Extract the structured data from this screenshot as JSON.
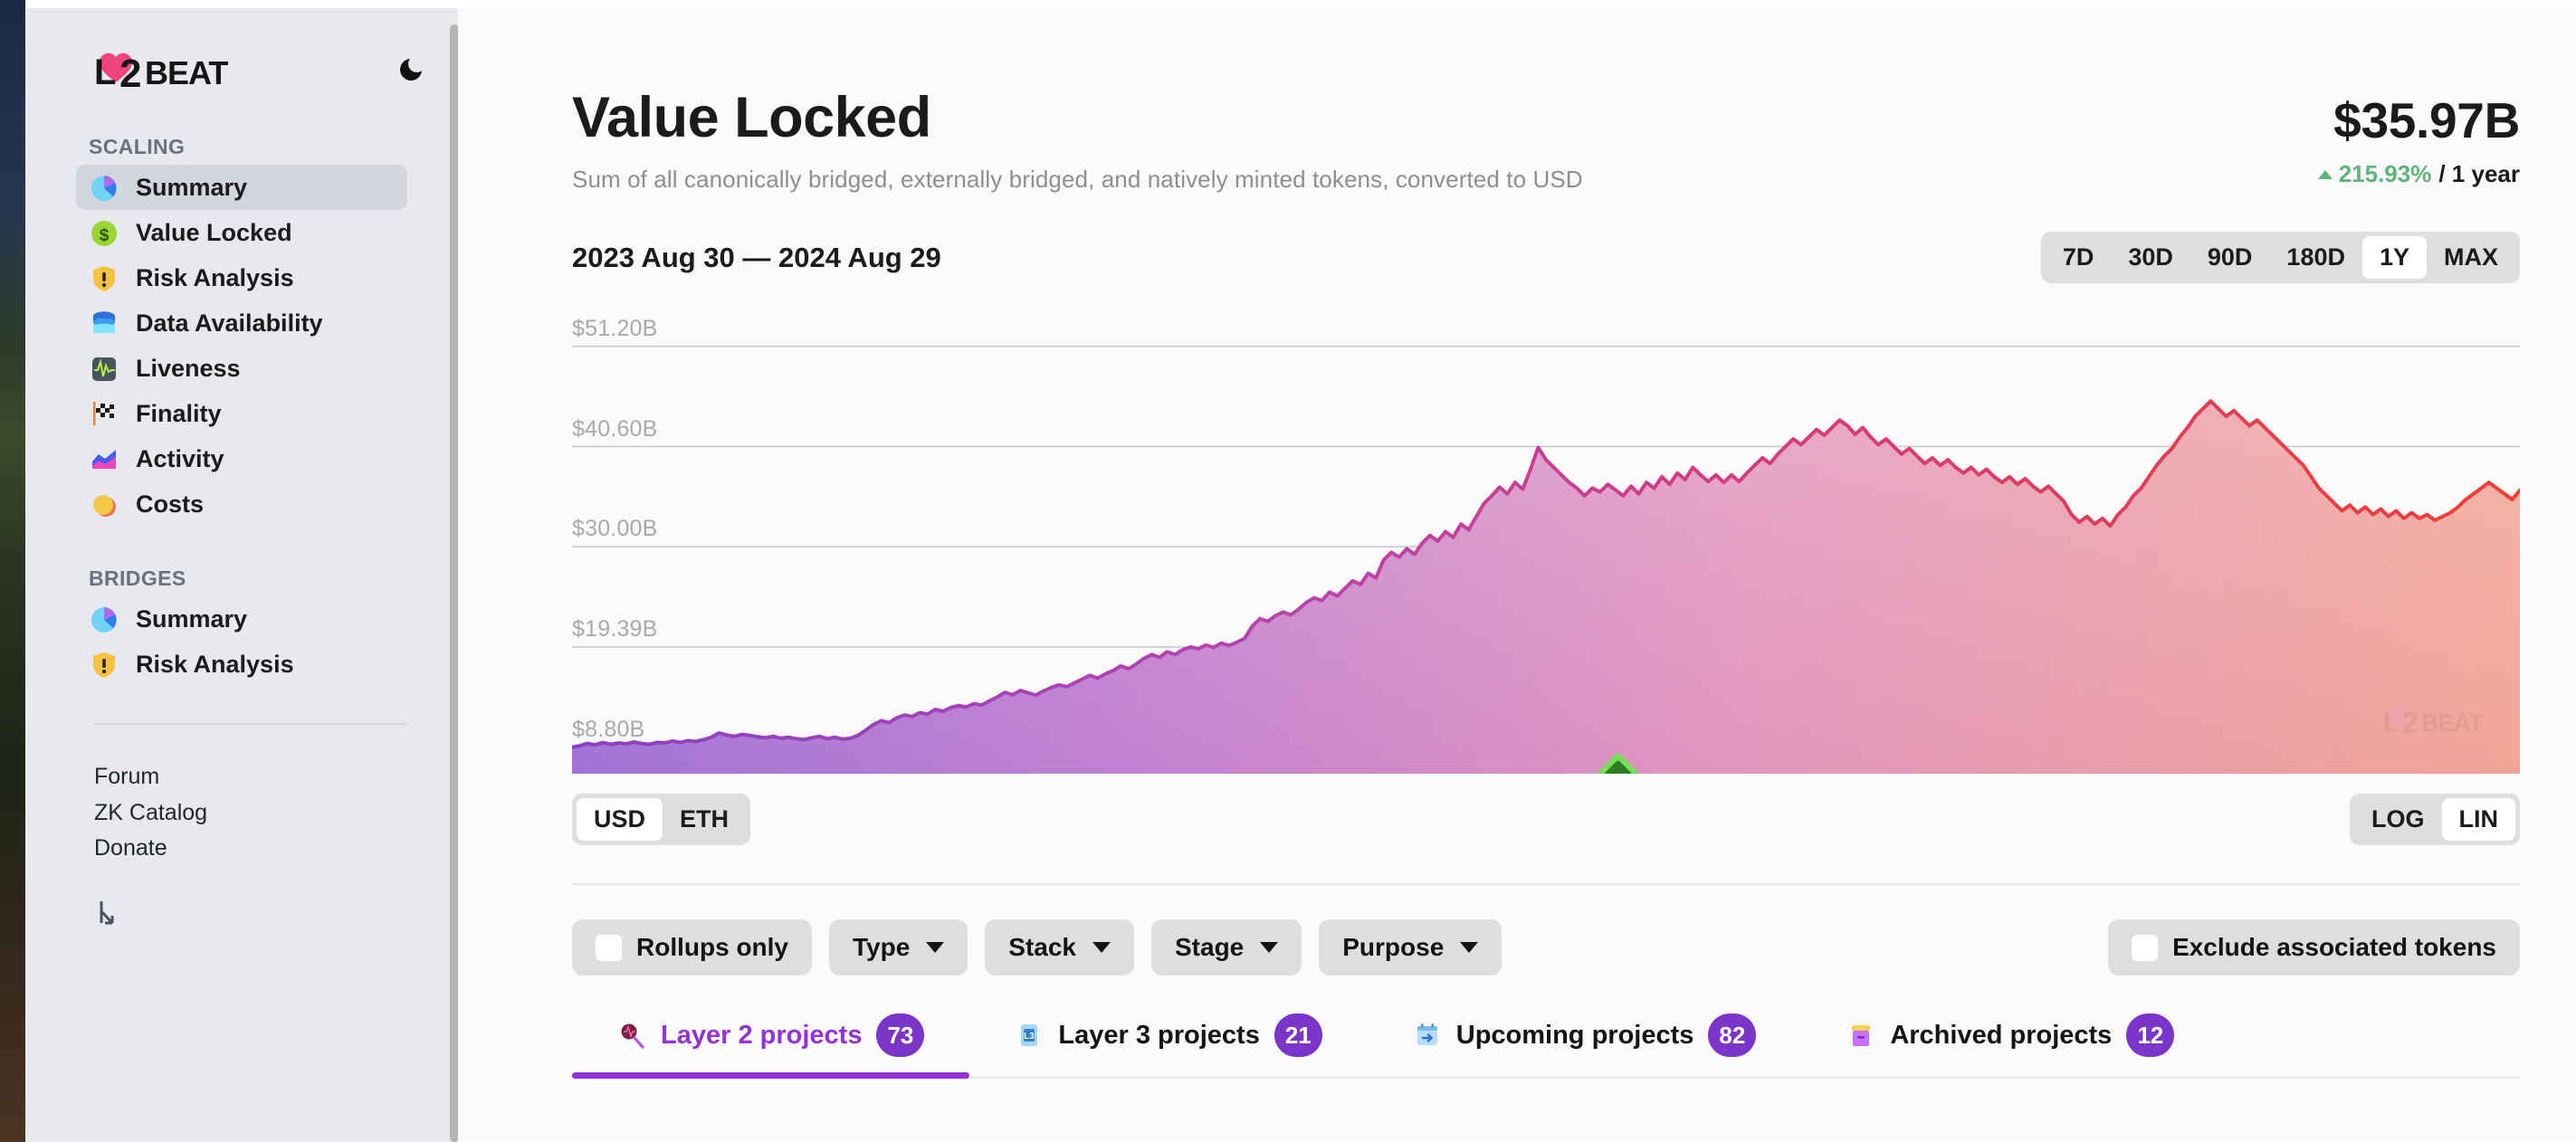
{
  "brand": {
    "name": "L2BEAT",
    "logo_text_l": "L",
    "logo_text_2": "2",
    "logo_text_beat": "BEAT",
    "theme_toggle_icon": "moon-icon"
  },
  "sidebar": {
    "sections": [
      {
        "title": "SCALING",
        "items": [
          {
            "label": "Summary",
            "icon": "pie-chart-icon",
            "active": true
          },
          {
            "label": "Value Locked",
            "icon": "dollar-circle-icon",
            "active": false
          },
          {
            "label": "Risk Analysis",
            "icon": "shield-warning-icon",
            "active": false
          },
          {
            "label": "Data Availability",
            "icon": "database-icon",
            "active": false
          },
          {
            "label": "Liveness",
            "icon": "pulse-icon",
            "active": false
          },
          {
            "label": "Finality",
            "icon": "checkered-flag-icon",
            "active": false
          },
          {
            "label": "Activity",
            "icon": "area-chart-icon",
            "active": false
          },
          {
            "label": "Costs",
            "icon": "coin-icon",
            "active": false
          }
        ]
      },
      {
        "title": "BRIDGES",
        "items": [
          {
            "label": "Summary",
            "icon": "pie-chart-icon",
            "active": false
          },
          {
            "label": "Risk Analysis",
            "icon": "shield-warning-icon",
            "active": false
          }
        ]
      }
    ],
    "links": [
      "Forum",
      "ZK Catalog",
      "Donate"
    ]
  },
  "header": {
    "title": "Value Locked",
    "subtitle": "Sum of all canonically bridged, externally bridged, and natively minted tokens, converted to USD",
    "value": "$35.97B",
    "change_pct": "215.93%",
    "change_period": "/ 1 year",
    "change_direction": "up",
    "change_color": "#62b37a"
  },
  "range": {
    "label": "2023 Aug 30 — 2024 Aug 29",
    "options": [
      "7D",
      "30D",
      "90D",
      "180D",
      "1Y",
      "MAX"
    ],
    "selected": "1Y"
  },
  "unit_toggle": {
    "options": [
      "USD",
      "ETH"
    ],
    "selected": "USD"
  },
  "scale_toggle": {
    "options": [
      "LOG",
      "LIN"
    ],
    "selected": "LIN"
  },
  "chart_watermark": "L2BEAT",
  "filters": {
    "rollups_only": {
      "label": "Rollups only",
      "checked": false
    },
    "dropdowns": [
      {
        "label": "Type"
      },
      {
        "label": "Stack"
      },
      {
        "label": "Stage"
      },
      {
        "label": "Purpose"
      }
    ],
    "exclude_associated": {
      "label": "Exclude associated tokens",
      "checked": false
    }
  },
  "tabs": [
    {
      "label": "Layer 2 projects",
      "count": "73",
      "icon": "layer2-icon",
      "active": true
    },
    {
      "label": "Layer 3 projects",
      "count": "21",
      "icon": "layer3-icon",
      "active": false
    },
    {
      "label": "Upcoming projects",
      "count": "82",
      "icon": "calendar-arrow-icon",
      "active": false
    },
    {
      "label": "Archived projects",
      "count": "12",
      "icon": "archive-box-icon",
      "active": false
    }
  ],
  "chart_data": {
    "type": "area",
    "title": "Value Locked",
    "xlabel": "",
    "ylabel": "USD",
    "grid": true,
    "legend": "none",
    "x_range": [
      "2023 Aug 30",
      "2024 Aug 29"
    ],
    "y_tick_labels": [
      "$51.20B",
      "$40.60B",
      "$30.00B",
      "$19.39B",
      "$8.80B"
    ],
    "y_tick_values": [
      51.2,
      40.6,
      30.0,
      19.39,
      8.8
    ],
    "ylim": [
      6.0,
      55.0
    ],
    "unit": "B USD",
    "marker": {
      "name": "milestone-marker",
      "shape": "diamond",
      "color": "#2e7d1f",
      "x_fraction": 0.537
    },
    "series": [
      {
        "name": "Value Locked",
        "line_color_start": "#8b3fc4",
        "line_color_end": "#ef3e33",
        "fill_gradient": [
          "#b38ad8",
          "#f0a79a"
        ],
        "values": [
          8.8,
          8.95,
          9.2,
          9.05,
          9.3,
          9.1,
          9.25,
          9.15,
          9.35,
          9.2,
          9.1,
          9.3,
          9.25,
          9.45,
          9.3,
          9.5,
          9.4,
          9.6,
          9.85,
          10.3,
          10.1,
          9.95,
          10.15,
          10.05,
          9.9,
          9.8,
          9.95,
          9.75,
          9.85,
          9.7,
          9.6,
          9.8,
          9.95,
          9.7,
          9.85,
          9.65,
          9.75,
          10.05,
          10.6,
          11.2,
          11.6,
          11.4,
          11.9,
          12.2,
          12.05,
          12.45,
          12.3,
          12.8,
          12.6,
          13.0,
          13.2,
          13.05,
          13.4,
          13.25,
          13.7,
          14.1,
          14.6,
          14.35,
          14.8,
          14.55,
          14.3,
          14.75,
          15.1,
          15.4,
          15.2,
          15.6,
          16.0,
          16.4,
          16.1,
          16.55,
          16.9,
          17.4,
          17.1,
          17.6,
          18.2,
          18.6,
          18.3,
          18.9,
          18.6,
          19.1,
          19.4,
          19.2,
          19.6,
          19.35,
          19.8,
          19.55,
          19.9,
          20.3,
          21.6,
          22.4,
          22.1,
          22.7,
          23.1,
          22.8,
          23.4,
          24.1,
          24.6,
          24.3,
          25.2,
          24.8,
          25.6,
          26.4,
          26.0,
          27.2,
          26.7,
          28.6,
          29.4,
          28.9,
          29.8,
          29.2,
          30.4,
          31.2,
          30.6,
          31.6,
          31.0,
          32.4,
          31.8,
          33.2,
          34.6,
          35.4,
          36.3,
          35.6,
          36.8,
          36.1,
          38.2,
          40.5,
          39.2,
          38.4,
          37.6,
          36.8,
          36.2,
          35.4,
          36.2,
          35.8,
          36.6,
          36.0,
          35.4,
          36.4,
          35.6,
          36.8,
          36.2,
          37.4,
          36.6,
          37.8,
          37.1,
          38.4,
          37.6,
          36.9,
          37.6,
          36.8,
          37.6,
          36.9,
          37.8,
          38.6,
          39.4,
          38.8,
          39.8,
          40.6,
          41.4,
          40.8,
          41.6,
          42.4,
          41.8,
          42.6,
          43.4,
          42.8,
          41.9,
          42.6,
          41.6,
          40.8,
          41.4,
          40.6,
          39.8,
          40.4,
          39.6,
          38.8,
          39.4,
          38.6,
          39.2,
          38.4,
          37.8,
          38.4,
          37.6,
          38.2,
          37.4,
          36.8,
          37.4,
          36.6,
          37.2,
          36.4,
          35.8,
          36.4,
          35.6,
          34.8,
          33.4,
          32.6,
          33.2,
          32.4,
          33.0,
          32.2,
          33.4,
          34.2,
          35.4,
          36.2,
          37.4,
          38.6,
          39.6,
          40.4,
          41.6,
          42.6,
          43.8,
          44.6,
          45.4,
          44.6,
          43.8,
          44.4,
          43.6,
          42.8,
          43.4,
          42.6,
          41.8,
          41.0,
          40.2,
          39.4,
          38.6,
          37.4,
          36.2,
          35.4,
          34.6,
          33.8,
          34.4,
          33.6,
          34.2,
          33.4,
          34.0,
          33.2,
          33.8,
          33.0,
          33.6,
          33.0,
          33.4,
          32.8,
          33.2,
          33.6,
          34.2,
          35.0,
          35.6,
          36.2,
          36.8,
          36.2,
          35.6,
          35.0,
          35.97
        ]
      }
    ]
  }
}
